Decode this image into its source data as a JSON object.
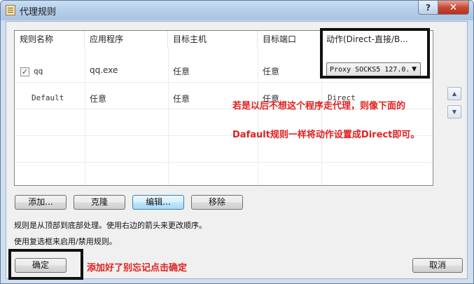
{
  "window": {
    "title": "代理规则",
    "help_label": "?",
    "close_label": "✕"
  },
  "table": {
    "headers": [
      "规则名称",
      "应用程序",
      "目标主机",
      "目标端口",
      "动作(Direct-直接/B..."
    ],
    "rows": [
      {
        "checked": true,
        "check_mark": "✓",
        "name": "qq",
        "app": "qq.exe",
        "host": "任意",
        "port": "任意",
        "action": "Proxy SOCKS5 127.0.",
        "action_arrow": "▼"
      },
      {
        "name": "Default",
        "app": "任意",
        "host": "任意",
        "port": "任意",
        "action": "Direct"
      }
    ]
  },
  "annotations": {
    "line1": "若是以后不想这个程序走代理，则像下面的",
    "line2": "Dafault规则一样将动作设置成Direct即可。",
    "ok_hint": "添加好了别忘记点击确定"
  },
  "order_buttons": {
    "up": "▲",
    "down": "▼"
  },
  "buttons": {
    "add": "添加...",
    "clone": "克隆",
    "edit": "编辑...",
    "remove": "移除",
    "ok": "确定",
    "cancel": "取消"
  },
  "info": {
    "line1": "规则是从顶部到底部处理。使用右边的箭头来更改顺序。",
    "line2": "使用复选框来启用/禁用规则。"
  },
  "colors": {
    "annotation": "#e02020",
    "highlight_box": "#111111",
    "close_button": "#c74a35"
  }
}
